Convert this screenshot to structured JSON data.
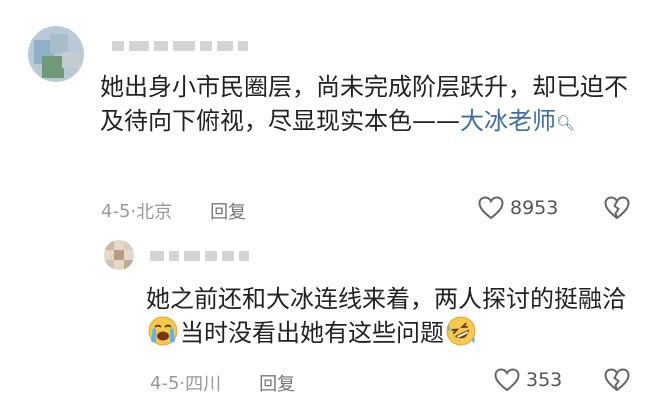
{
  "comments": [
    {
      "text": "她出身小市民圈层，尚未完成阶层跃升，却已迫不及待向下俯视，尽显现实本色——",
      "link_text": "大冰老师",
      "date": "4-5",
      "separator": "·",
      "location": "北京",
      "reply_label": "回复",
      "likes": "8953"
    },
    {
      "text_before_emoji": "她之前还和大冰连线来着，两人探讨的挺融洽",
      "text_after_emoji": "当时没看出她有这些问题",
      "date": "4-5",
      "separator": "·",
      "location": "四川",
      "reply_label": "回复",
      "likes": "353"
    }
  ],
  "icons": {
    "link_search": "search-icon",
    "like": "heart-icon",
    "dislike": "broken-heart-icon",
    "emoji_1": "loudly-crying-face-icon",
    "emoji_2": "rolling-on-floor-laughing-icon"
  },
  "colors": {
    "text": "#222222",
    "link": "#3d6ea8",
    "meta": "#999999"
  }
}
